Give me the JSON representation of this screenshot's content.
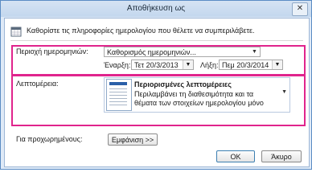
{
  "window": {
    "title": "Αποθήκευση ως",
    "close_glyph": "✕"
  },
  "intro": {
    "text": "Καθορίστε τις πληροφορίες ημερολογίου που θέλετε να συμπεριλάβετε."
  },
  "date_range": {
    "label": "Περιοχή ημερομηνιών:",
    "value": "Καθορισμός ημερομηνιών...",
    "start_label": "Έναρξη:",
    "start_value": "Τετ 20/3/2013",
    "end_label": "Λήξη:",
    "end_value": "Πεμ 20/3/2014"
  },
  "detail": {
    "label": "Λεπτομέρεια:",
    "title": "Περιορισμένες λεπτομέρειες",
    "description": "Περιλαμβάνει τη διαθεσιμότητα και τα θέματα των στοιχείων ημερολογίου μόνο"
  },
  "advanced": {
    "label": "Για προχωρημένους:",
    "button": "Εμφάνιση >>"
  },
  "buttons": {
    "ok": "OK",
    "cancel": "Άκυρο"
  },
  "icons": {
    "dropdown": "chevron-down-icon",
    "calendar": "calendar-icon"
  },
  "colors": {
    "highlight": "#e0248d",
    "title_bar": "#c3d7ee"
  }
}
